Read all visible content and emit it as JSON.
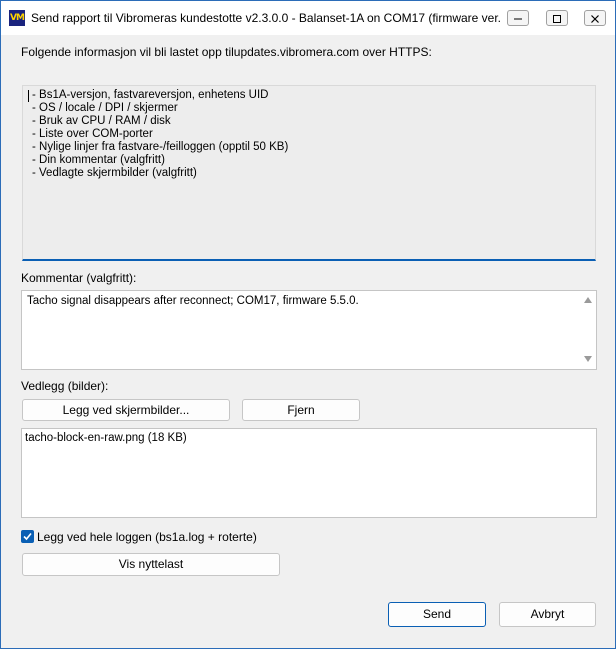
{
  "window": {
    "title": "Send rapport til Vibromeras kundestotte v2.3.0.0 - Balanset-1A on COM17 (firmware ver....",
    "icon_text": "VM"
  },
  "intro": "Folgende informasjon vil bli lastet opp tilupdates.vibromera.com over HTTPS:",
  "info_items": [
    "- Bs1A-versjon, fastvareversjon, enhetens UID",
    "- OS / locale / DPI / skjermer",
    "- Bruk av CPU / RAM / disk",
    "- Liste over COM-porter",
    "- Nylige linjer fra fastvare-/feilloggen (opptil 50 KB)",
    "- Din kommentar (valgfritt)",
    "- Vedlagte skjermbilder (valgfritt)"
  ],
  "comment": {
    "label": "Kommentar (valgfritt):",
    "value": "Tacho signal disappears after reconnect; COM17, firmware 5.5.0."
  },
  "attachments": {
    "label": "Vedlegg (bilder):",
    "add_button": "Legg ved skjermbilder...",
    "remove_button": "Fjern",
    "items": [
      "tacho-block-en-raw.png (18 KB)"
    ]
  },
  "include_log": {
    "label": "Legg ved hele loggen (bs1a.log + roterte)",
    "checked": true
  },
  "show_payload_button": "Vis nyttelast",
  "send_button": "Send",
  "cancel_button": "Avbryt",
  "colors": {
    "accent": "#0a5fb4",
    "window_border": "#2b6cb8",
    "icon_bg": "#1a237e",
    "icon_fg": "#ffd400"
  }
}
